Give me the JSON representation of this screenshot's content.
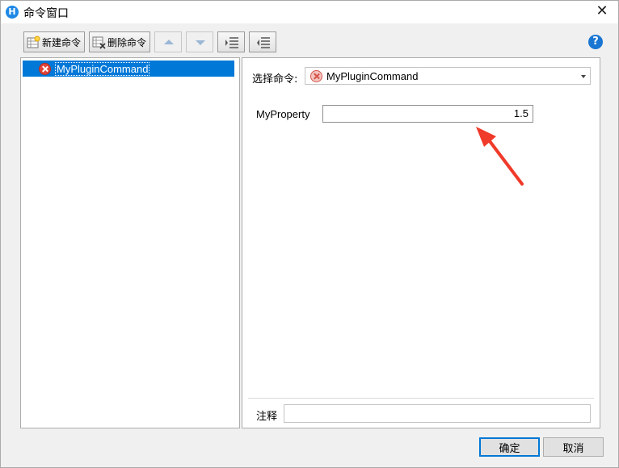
{
  "window": {
    "title": "命令窗口",
    "app_icon": "hz-app-icon"
  },
  "toolbar": {
    "new_label": "新建命令",
    "delete_label": "删除命令",
    "move_up_icon": "arrow-up-icon",
    "move_down_icon": "arrow-down-icon",
    "indent_icon": "indent-icon",
    "outdent_icon": "outdent-icon",
    "help_glyph": "?"
  },
  "tree": {
    "items": [
      {
        "label": "MyPluginCommand",
        "icon": "error-icon",
        "selected": true
      }
    ]
  },
  "editor": {
    "select_label": "选择命令:",
    "select_value": "MyPluginCommand",
    "property": {
      "name": "MyProperty",
      "value": "1.5"
    },
    "note_label": "注释",
    "note_value": ""
  },
  "footer": {
    "ok_label": "确定",
    "cancel_label": "取消"
  },
  "colors": {
    "selection": "#0078d7",
    "error": "#e0443a",
    "annotation_arrow": "#f03a2a",
    "help": "#1976d2"
  }
}
